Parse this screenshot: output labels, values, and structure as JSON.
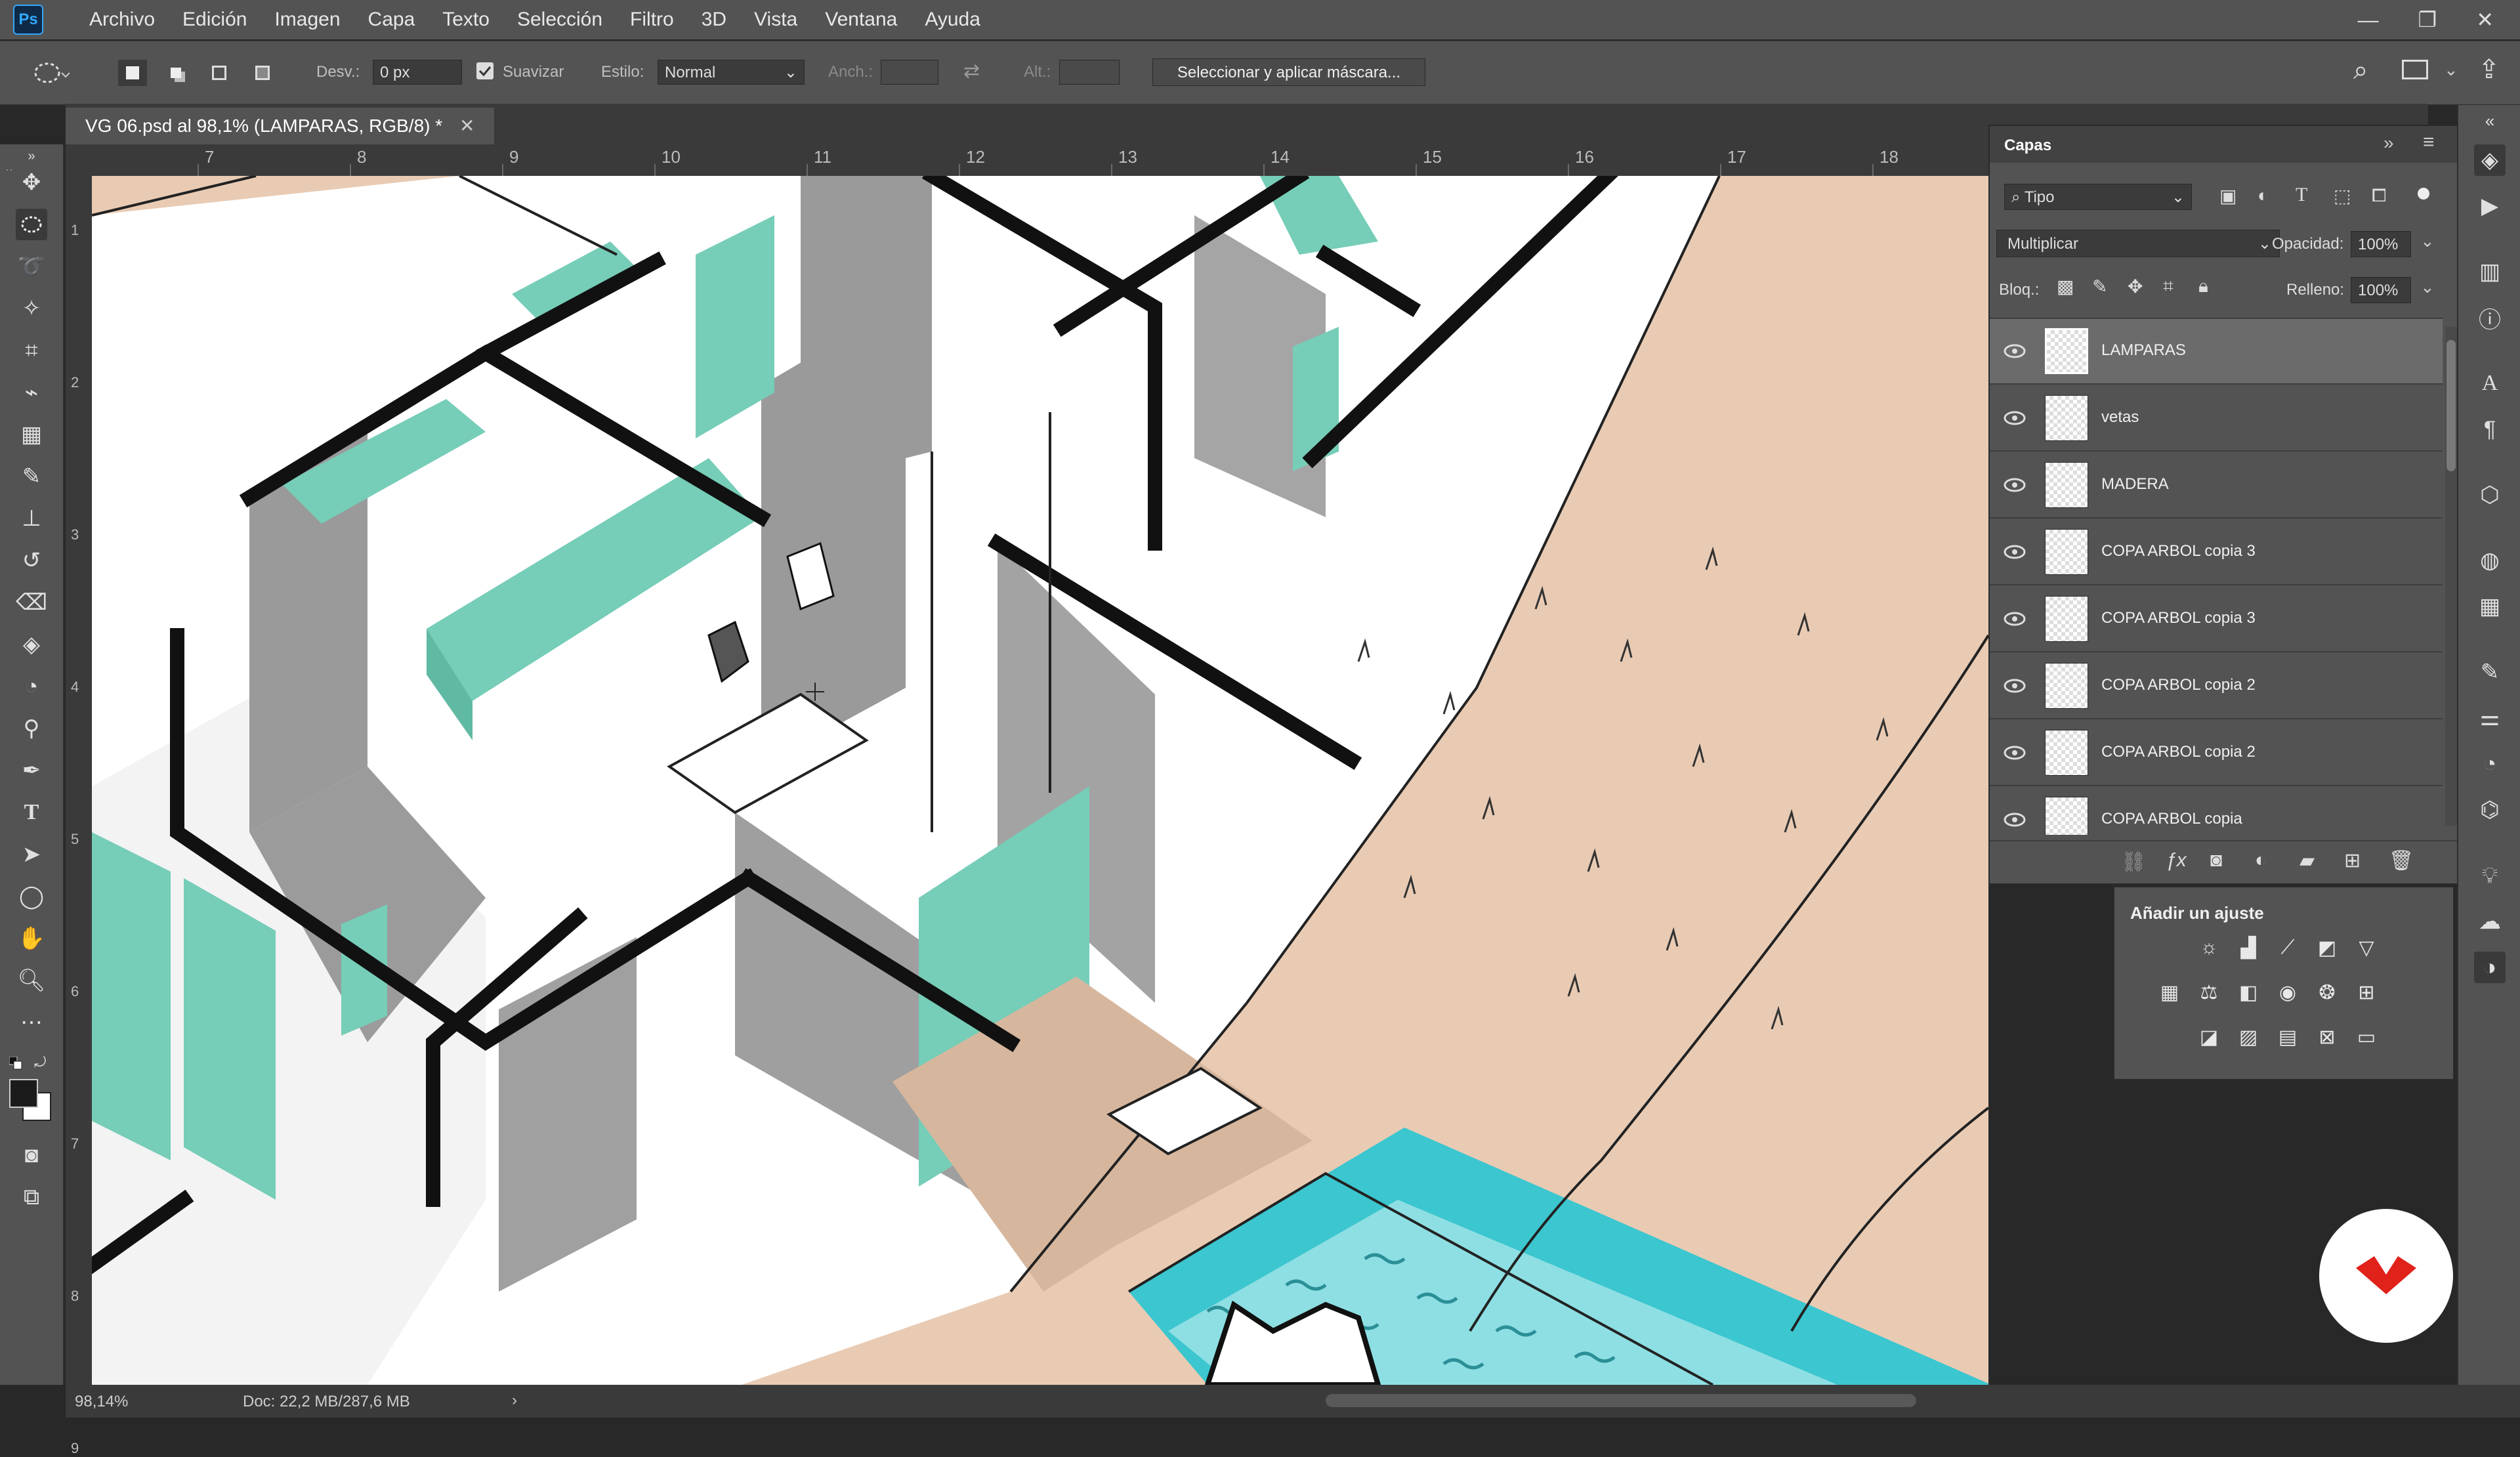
{
  "menubar": {
    "logo": "Ps",
    "items": [
      "Archivo",
      "Edición",
      "Imagen",
      "Capa",
      "Texto",
      "Selección",
      "Filtro",
      "3D",
      "Vista",
      "Ventana",
      "Ayuda"
    ]
  },
  "options": {
    "desv_label": "Desv.:",
    "desv_value": "0 px",
    "suavizar_label": "Suavizar",
    "estilo_label": "Estilo:",
    "estilo_value": "Normal",
    "anch_label": "Anch.:",
    "alt_label": "Alt.:",
    "mask_button": "Seleccionar y aplicar máscara..."
  },
  "document": {
    "tab_title": "VG 06.psd al 98,1% (LAMPARAS, RGB/8) *"
  },
  "rulers": {
    "top": [
      "7",
      "8",
      "9",
      "10",
      "11",
      "12",
      "13",
      "14",
      "15",
      "16",
      "17",
      "18"
    ],
    "left": [
      "1",
      "2",
      "3",
      "4",
      "5",
      "6",
      "7",
      "8",
      "9"
    ]
  },
  "status": {
    "zoom": "98,14%",
    "doc": "Doc: 22,2 MB/287,6 MB"
  },
  "layers_panel": {
    "title": "Capas",
    "filter_value": "Tipo",
    "blend_mode": "Multiplicar",
    "opacity_label": "Opacidad:",
    "opacity_value": "100%",
    "lock_label": "Bloq.:",
    "fill_label": "Relleno:",
    "fill_value": "100%",
    "layers": [
      {
        "name": "LAMPARAS"
      },
      {
        "name": "vetas"
      },
      {
        "name": "MADERA"
      },
      {
        "name": "COPA ARBOL copia 3"
      },
      {
        "name": "COPA ARBOL copia 3"
      },
      {
        "name": "COPA ARBOL copia 2"
      },
      {
        "name": "COPA ARBOL copia 2"
      },
      {
        "name": "COPA ARBOL copia"
      }
    ]
  },
  "adjustments_panel": {
    "title": "Añadir un ajuste"
  },
  "colors": {
    "accent_teal": "#76cdb8",
    "pool": "#3cc6cf",
    "floor_beige": "#e9cbb4",
    "wood": "#d6b79e",
    "wall_gray": "#9a9a9a",
    "selected_layer": "#6b6b6b"
  }
}
